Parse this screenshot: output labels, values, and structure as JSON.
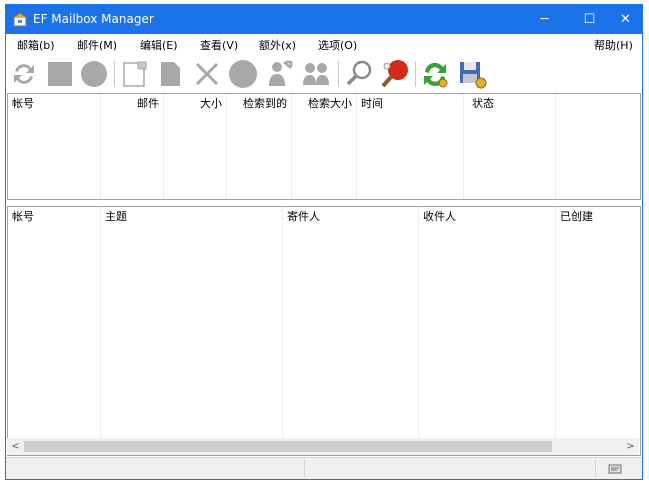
{
  "window": {
    "title": "EF Mailbox Manager"
  },
  "titlebar": {
    "minimize": "─",
    "maximize": "☐",
    "close": "✕"
  },
  "menu": {
    "items": [
      "邮箱(b)",
      "邮件(M)",
      "编辑(E)",
      "查看(V)",
      "额外(x)",
      "选项(O)"
    ],
    "help": "帮助(H)"
  },
  "toolbar": {
    "icons": [
      "refresh-icon",
      "stop-icon",
      "record-icon",
      "new-message-icon",
      "document-icon",
      "delete-icon",
      "circle-icon",
      "users-icon",
      "group-icon",
      "search-icon",
      "ping-pong-icon",
      "sync-icon",
      "save-icon"
    ]
  },
  "accounts_table": {
    "columns": [
      "帐号",
      "邮件",
      "大小",
      "检索到的",
      "检索大小",
      "时间",
      "状态"
    ],
    "rows": []
  },
  "messages_table": {
    "columns": [
      "帐号",
      "主题",
      "寄件人",
      "收件人",
      "已创建"
    ],
    "rows": []
  },
  "scrollbar": {
    "left_arrow": "<",
    "right_arrow": ">"
  },
  "colors": {
    "titlebar": "#1a73e8",
    "accent_green": "#3aa03a",
    "accent_red": "#d42a1a"
  }
}
